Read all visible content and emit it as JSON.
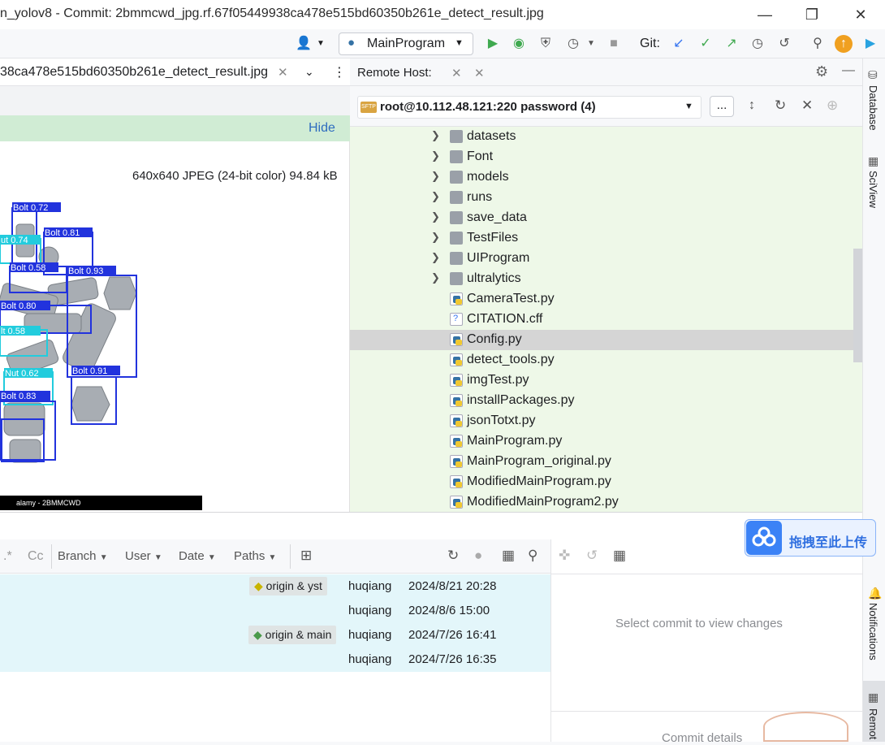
{
  "window": {
    "title": "n_yolov8 - Commit: 2bmmcwd_jpg.rf.67f05449938ca478e515bd60350b261e_detect_result.jpg"
  },
  "toolbar": {
    "run_config": "MainProgram",
    "git_label": "Git:"
  },
  "editor": {
    "tab_label": "38ca478e515bd60350b261e_detect_result.jpg",
    "hide_label": "Hide",
    "image_info": "640x640 JPEG (24-bit color) 94.84 kB",
    "photo_caption": "alamy - 2BMMCWD",
    "detections": [
      {
        "label": "Bolt 0.72",
        "kind": "bolt"
      },
      {
        "label": "ut 0.74",
        "kind": "nut"
      },
      {
        "label": "Bolt 0.81",
        "kind": "bolt"
      },
      {
        "label": "Bolt 0.58",
        "kind": "bolt"
      },
      {
        "label": "Bolt 0.93",
        "kind": "bolt"
      },
      {
        "label": "Bolt 0.80",
        "kind": "bolt"
      },
      {
        "label": "lt 0.58",
        "kind": "bolt"
      },
      {
        "label": "Nut 0.62",
        "kind": "nut"
      },
      {
        "label": "Bolt 0.91",
        "kind": "bolt"
      },
      {
        "label": "Bolt 0.83",
        "kind": "bolt"
      }
    ]
  },
  "remote": {
    "title": "Remote Host:",
    "host": "root@10.112.48.121:220 password (4)",
    "dots": "...",
    "items": [
      {
        "name": "datasets",
        "type": "folder"
      },
      {
        "name": "Font",
        "type": "folder"
      },
      {
        "name": "models",
        "type": "folder"
      },
      {
        "name": "runs",
        "type": "folder"
      },
      {
        "name": "save_data",
        "type": "folder"
      },
      {
        "name": "TestFiles",
        "type": "folder"
      },
      {
        "name": "UIProgram",
        "type": "folder"
      },
      {
        "name": "ultralytics",
        "type": "folder"
      },
      {
        "name": "CameraTest.py",
        "type": "py"
      },
      {
        "name": "CITATION.cff",
        "type": "cff"
      },
      {
        "name": "Config.py",
        "type": "py",
        "selected": true
      },
      {
        "name": "detect_tools.py",
        "type": "py"
      },
      {
        "name": "imgTest.py",
        "type": "py"
      },
      {
        "name": "installPackages.py",
        "type": "py"
      },
      {
        "name": "jsonTotxt.py",
        "type": "py"
      },
      {
        "name": "MainProgram.py",
        "type": "py"
      },
      {
        "name": "MainProgram_original.py",
        "type": "py"
      },
      {
        "name": "ModifiedMainProgram.py",
        "type": "py"
      },
      {
        "name": "ModifiedMainProgram2.py",
        "type": "py"
      }
    ]
  },
  "right_strip": {
    "database": "Database",
    "sciview": "SciView",
    "notifications": "Notifications",
    "remote": "Remot"
  },
  "git": {
    "filters": {
      "regex": ".*",
      "case": "Cc",
      "branch": "Branch",
      "user": "User",
      "date": "Date",
      "paths": "Paths"
    },
    "commits": [
      {
        "tag": "origin & yst",
        "author": "huqiang",
        "date": "2024/8/21 20:28"
      },
      {
        "tag": "",
        "author": "huqiang",
        "date": "2024/8/6 15:00"
      },
      {
        "tag": "origin & main",
        "author": "huqiang",
        "date": "2024/7/26 16:41"
      },
      {
        "tag": "",
        "author": "huqiang",
        "date": "2024/7/26 16:35"
      }
    ],
    "select_commit": "Select commit to view changes",
    "commit_details": "Commit details"
  },
  "upload": {
    "label": "拖拽至此上传"
  },
  "colors": {
    "accent": "#3574f0",
    "run": "#3fa94f",
    "hide_bar": "#d0ecd4",
    "remote_bg": "#eef8e8",
    "commit_row": "#e3f6fa"
  }
}
